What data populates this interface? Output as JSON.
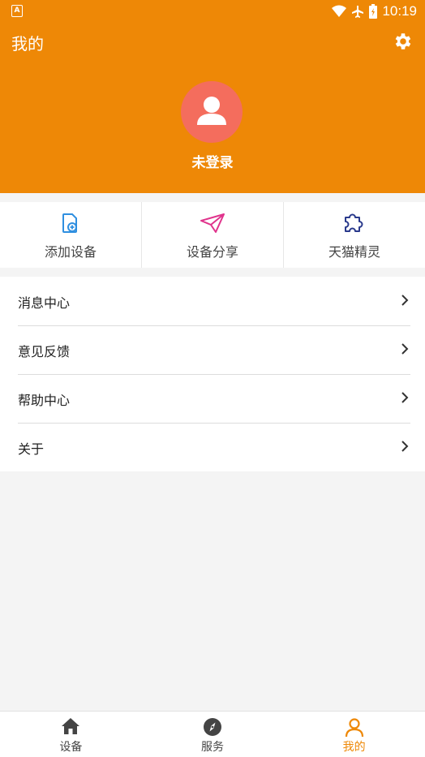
{
  "status_bar": {
    "time": "10:19"
  },
  "header": {
    "title": "我的",
    "login_text": "未登录"
  },
  "quick_actions": [
    {
      "label": "添加设备",
      "icon": "add-device-icon"
    },
    {
      "label": "设备分享",
      "icon": "paper-plane-icon"
    },
    {
      "label": "天猫精灵",
      "icon": "puzzle-icon"
    }
  ],
  "menu": [
    {
      "label": "消息中心"
    },
    {
      "label": "意见反馈"
    },
    {
      "label": "帮助中心"
    },
    {
      "label": "关于"
    }
  ],
  "tabs": [
    {
      "label": "设备",
      "icon": "home-icon"
    },
    {
      "label": "服务",
      "icon": "compass-icon"
    },
    {
      "label": "我的",
      "icon": "person-icon",
      "active": true
    }
  ],
  "colors": {
    "accent": "#ee8806",
    "avatar": "#f46d5d"
  }
}
